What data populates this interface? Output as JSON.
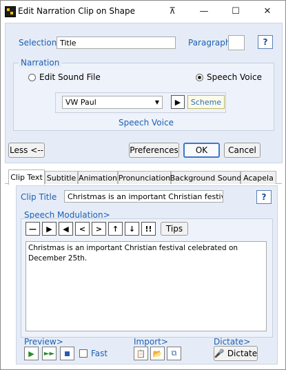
{
  "window": {
    "title": "Edit Narration Clip on Shape",
    "pin_glyph": "⊼",
    "minimize_glyph": "—",
    "maximize_glyph": "☐",
    "close_glyph": "✕"
  },
  "selection": {
    "label": "Selection",
    "value": "Title"
  },
  "paragraph": {
    "label": "Paragraph",
    "value": ""
  },
  "help_label": "?",
  "narration": {
    "label": "Narration",
    "option_file": "Edit Sound File",
    "option_voice": "Speech Voice",
    "selected": "Speech Voice",
    "voice_value": "VW Paul",
    "play_glyph": "▶",
    "scheme_label": "Scheme",
    "caption": "Speech Voice"
  },
  "buttons": {
    "less": "Less <--",
    "preferences": "Preferences",
    "ok": "OK",
    "cancel": "Cancel"
  },
  "tabs": [
    "Clip Text",
    "Subtitle",
    "Animation",
    "Pronunciation",
    "Background Sound",
    "Acapela"
  ],
  "active_tab": "Clip Text",
  "clip": {
    "title_label": "Clip Title",
    "title_value": "Christmas is an important Christian festival celeb",
    "modulation_label": "Speech Modulation>",
    "mod_symbols": [
      "—",
      "▶",
      "◀",
      "<",
      ">",
      "↑",
      "↓",
      "!!"
    ],
    "tips_label": "Tips",
    "text": "Christmas is an important Christian festival celebrated on December 25th.",
    "preview_label": "Preview>",
    "fast_label": "Fast",
    "fast_checked": false,
    "import_label": "Import>",
    "dictate_caption": "Dictate>",
    "dictate_button": "Dictate"
  },
  "colors": {
    "label_blue": "#1a5fb4",
    "panel_bg": "#e6ecf7",
    "ok_border": "#3a78c9"
  },
  "icons": [
    "app-icon",
    "pin-icon",
    "minimize-icon",
    "maximize-icon",
    "close-icon",
    "dropdown-arrow-icon",
    "play-icon",
    "stop-icon",
    "fast-forward-icon",
    "clipboard-paste-icon",
    "folder-open-icon",
    "copy-pages-icon",
    "microphone-icon"
  ]
}
